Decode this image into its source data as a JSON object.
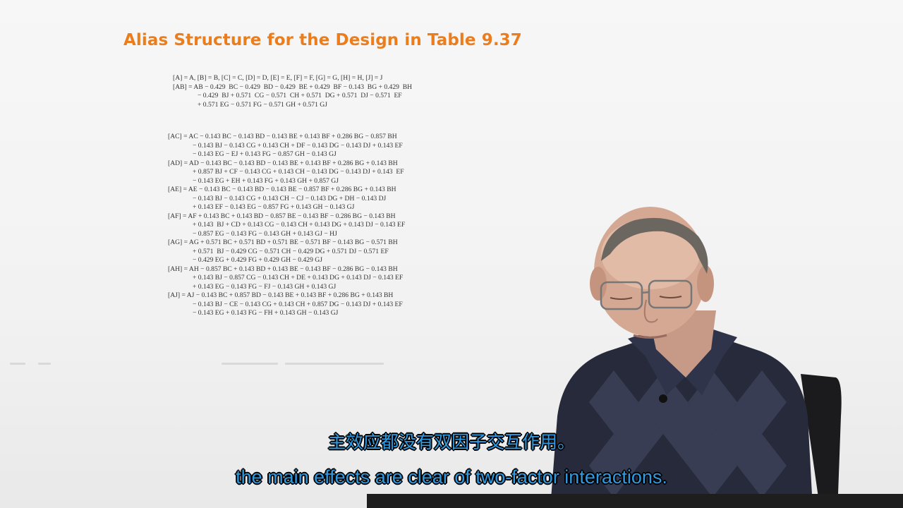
{
  "slide": {
    "title": "Alias Structure for the Design in Table 9.37",
    "main_lines": [
      "[A] = A, [B] = B, [C] = C, [D] = D, [E] = E, [F] = F, [G] = G, [H] = H, [J] = J",
      "[AB] = AB − 0.429  BC − 0.429  BD − 0.429  BE + 0.429  BF − 0.143  BG + 0.429  BH",
      "− 0.429  BJ + 0.571  CG − 0.571  CH + 0.571  DG + 0.571  DJ − 0.571  EF",
      "+ 0.571 EG − 0.571 FG − 0.571 GH + 0.571 GJ"
    ],
    "alias_lines": [
      "[AC] = AC − 0.143 BC − 0.143 BD − 0.143 BE + 0.143 BF + 0.286 BG − 0.857 BH",
      "− 0.143 BJ − 0.143 CG + 0.143 CH + DF − 0.143 DG − 0.143 DJ + 0.143 EF",
      "− 0.143 EG − EJ + 0.143 FG − 0.857 GH − 0.143 GJ",
      "[AD] = AD − 0.143 BC − 0.143 BD − 0.143 BE + 0.143 BF + 0.286 BG + 0.143 BH",
      "+ 0.857 BJ + CF − 0.143 CG + 0.143 CH − 0.143 DG − 0.143 DJ + 0.143  EF",
      "− 0.143 EG + EH + 0.143 FG + 0.143 GH + 0.857 GJ",
      "[AE] = AE − 0.143 BC − 0.143 BD − 0.143 BE − 0.857 BF + 0.286 BG + 0.143 BH",
      "− 0.143 BJ − 0.143 CG + 0.143 CH − CJ − 0.143 DG + DH − 0.143 DJ",
      "+ 0.143 EF − 0.143 EG − 0.857 FG + 0.143 GH − 0.143 GJ",
      "[AF] = AF + 0.143 BC + 0.143 BD − 0.857 BE − 0.143 BF − 0.286 BG − 0.143 BH",
      "+ 0.143  BJ + CD + 0.143 CG − 0.143 CH + 0.143 DG + 0.143 DJ − 0.143 EF",
      "− 0.857 EG − 0.143 FG − 0.143 GH + 0.143 GJ − HJ",
      "[AG] = AG + 0.571 BC + 0.571 BD + 0.571 BE − 0.571 BF − 0.143 BG − 0.571 BH",
      "+ 0.571  BJ − 0.429 CG − 0.571 CH − 0.429 DG + 0.571 DJ − 0.571 EF",
      "− 0.429 EG + 0.429 FG + 0.429 GH − 0.429 GJ",
      "[AH] = AH − 0.857 BC + 0.143 BD + 0.143 BE − 0.143 BF − 0.286 BG − 0.143 BH",
      "+ 0.143 BJ − 0.857 CG − 0.143 CH + DE + 0.143 DG + 0.143 DJ − 0.143 EF",
      "+ 0.143 EG − 0.143 FG − FJ − 0.143 GH + 0.143 GJ",
      "[AJ] = AJ − 0.143 BC + 0.857 BD − 0.143 BE + 0.143 BF + 0.286 BG + 0.143 BH",
      "− 0.143 BJ − CE − 0.143 CG + 0.143 CH + 0.857 DG − 0.143 DJ + 0.143 EF",
      "− 0.143 EG + 0.143 FG − FH + 0.143 GH − 0.143 GJ"
    ]
  },
  "subtitles": {
    "chinese": "主效应都没有双因子交互作用。",
    "english": "the main effects are clear of two-factor interactions."
  },
  "colors": {
    "title": "#ec7d1c",
    "subtitle_fill": "#2f9ae0",
    "subtitle_outline": "#000000"
  }
}
